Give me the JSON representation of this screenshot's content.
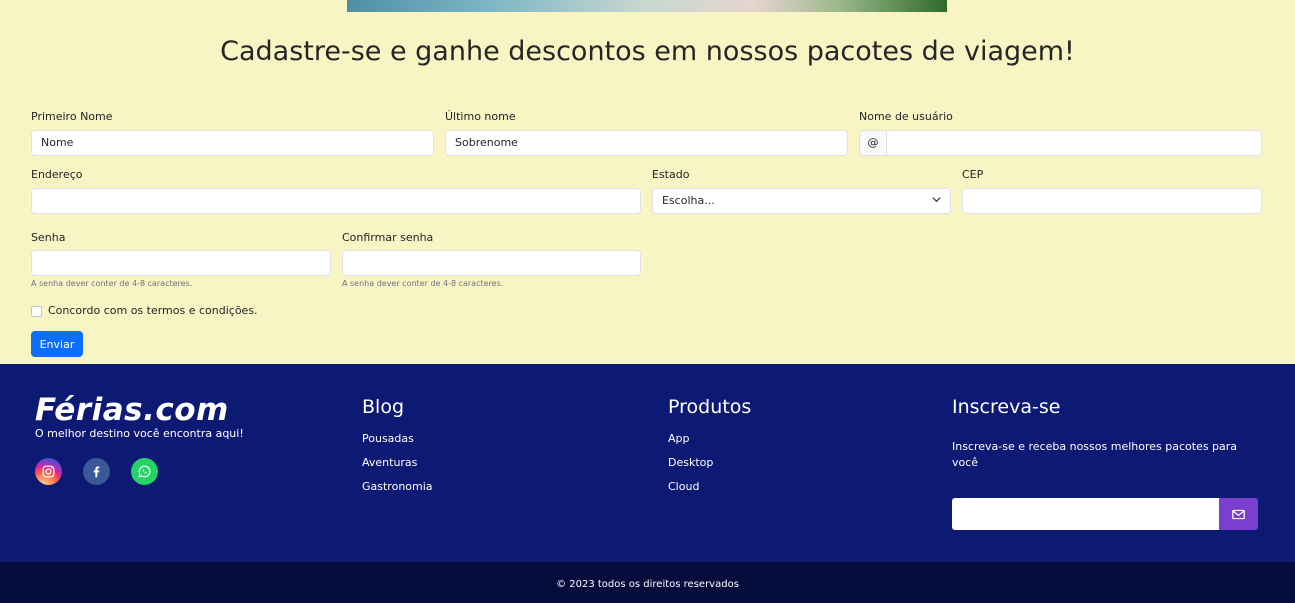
{
  "headline": "Cadastre-se e ganhe descontos em nossos pacotes de viagem!",
  "form": {
    "first_name_label": "Primeiro Nome",
    "first_name_value": "Nome",
    "last_name_label": "Último nome",
    "last_name_value": "Sobrenome",
    "username_label": "Nome de usuário",
    "username_prefix": "@",
    "username_value": "",
    "address_label": "Endereço",
    "address_value": "",
    "state_label": "Estado",
    "state_selected": "Escolha...",
    "cep_label": "CEP",
    "cep_value": "",
    "password_label": "Senha",
    "password_help": "A senha dever conter de 4-8 caracteres.",
    "confirm_label": "Confirmar senha",
    "confirm_help": "A senha dever conter de 4-8 caracteres.",
    "terms_label": "Concordo com os termos e condições.",
    "terms_checked": false,
    "submit_label": "Enviar"
  },
  "footer": {
    "logo_text": "Férias.com",
    "tagline": "O melhor destino você encontra aqui!",
    "social": [
      {
        "icon": "instagram-icon",
        "color": "#d6249f"
      },
      {
        "icon": "facebook-icon",
        "color": "#3b5998"
      },
      {
        "icon": "whatsapp-icon",
        "color": "#25d366"
      }
    ],
    "blog": {
      "title": "Blog",
      "links": [
        "Pousadas",
        "Aventuras",
        "Gastronomia"
      ]
    },
    "products": {
      "title": "Produtos",
      "links": [
        "App",
        "Desktop",
        "Cloud"
      ]
    },
    "subscribe": {
      "title": "Inscreva-se",
      "text": "Inscreva-se e receba nossos melhores pacotes para você",
      "input_value": "",
      "button_icon": "envelope-icon"
    },
    "copyright": "© 2023 todos os direitos reservados"
  },
  "colors": {
    "page_bg": "#f9f4c4",
    "footer_bg": "#0d1a73",
    "copyright_bg": "#060d3d",
    "primary_button": "#0d6efd",
    "subscribe_button": "#7b3fd0"
  }
}
